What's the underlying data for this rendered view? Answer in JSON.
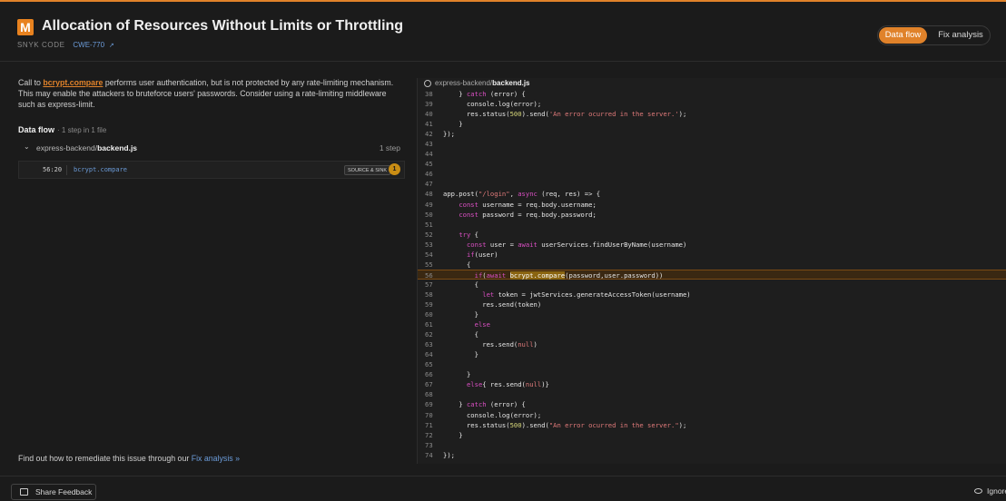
{
  "header": {
    "severity": "M",
    "title": "Allocation of Resources Without Limits or Throttling",
    "source": "SNYK CODE",
    "cwe": "CWE-770",
    "cwe_icon": "external-link-icon",
    "tabs": [
      "Data flow",
      "Fix analysis"
    ],
    "active_tab": "Data flow",
    "accent_color": "#e0822a"
  },
  "description": {
    "function_name": "bcrypt.compare",
    "prefix": "Call to ",
    "text": " performs user authentication, but is not protected by any rate-limiting mechanism. This may enable the attackers to bruteforce users' passwords. Consider using a rate-limiting middleware such as express-limit."
  },
  "data_flow": {
    "title": "Data flow",
    "subtitle": "· 1 step in 1 file",
    "file_dir": "express-backend/",
    "file_name": "backend.js",
    "step_count": "1 step",
    "steps": [
      {
        "location": "56:20",
        "function": "bcrypt.compare",
        "tag": "SOURCE & SINK",
        "number": "1"
      }
    ]
  },
  "remediation": {
    "text": "Find out how to remediate this issue through our ",
    "link": "Fix analysis »"
  },
  "code": {
    "file_dir": "express-backend/",
    "file_name": "backend.js",
    "highlight_line": 56,
    "lines": [
      {
        "n": "38",
        "t": "    } catch (error) {"
      },
      {
        "n": "39",
        "t": "      console.log(error);"
      },
      {
        "n": "40",
        "t": "      res.status(500).send('An error ocurred in the server.');"
      },
      {
        "n": "41",
        "t": "    }"
      },
      {
        "n": "42",
        "t": "});"
      },
      {
        "n": "43",
        "t": ""
      },
      {
        "n": "44",
        "t": ""
      },
      {
        "n": "45",
        "t": ""
      },
      {
        "n": "46",
        "t": ""
      },
      {
        "n": "47",
        "t": ""
      },
      {
        "n": "48",
        "t": "app.post(\"/login\", async (req, res) => {"
      },
      {
        "n": "49",
        "t": "    const username = req.body.username;"
      },
      {
        "n": "50",
        "t": "    const password = req.body.password;"
      },
      {
        "n": "51",
        "t": ""
      },
      {
        "n": "52",
        "t": "    try {"
      },
      {
        "n": "53",
        "t": "      const user = await userServices.findUserByName(username)"
      },
      {
        "n": "54",
        "t": "      if(user)"
      },
      {
        "n": "55",
        "t": "      {"
      },
      {
        "n": "56",
        "t": "        if(await bcrypt.compare(password,user.password))"
      },
      {
        "n": "57",
        "t": "        {"
      },
      {
        "n": "58",
        "t": "          let token = jwtServices.generateAccessToken(username)"
      },
      {
        "n": "59",
        "t": "          res.send(token)"
      },
      {
        "n": "60",
        "t": "        }"
      },
      {
        "n": "61",
        "t": "        else"
      },
      {
        "n": "62",
        "t": "        {"
      },
      {
        "n": "63",
        "t": "          res.send(null)"
      },
      {
        "n": "64",
        "t": "        }"
      },
      {
        "n": "65",
        "t": ""
      },
      {
        "n": "66",
        "t": "      }"
      },
      {
        "n": "67",
        "t": "      else{ res.send(null)}"
      },
      {
        "n": "68",
        "t": ""
      },
      {
        "n": "69",
        "t": "    } catch (error) {"
      },
      {
        "n": "70",
        "t": "      console.log(error);"
      },
      {
        "n": "71",
        "t": "      res.status(500).send(\"An error ocurred in the server.\");"
      },
      {
        "n": "72",
        "t": "    }"
      },
      {
        "n": "73",
        "t": ""
      },
      {
        "n": "74",
        "t": "});"
      }
    ]
  },
  "footer": {
    "feedback_label": "Share Feedback",
    "ignore_label": "Ignore"
  }
}
